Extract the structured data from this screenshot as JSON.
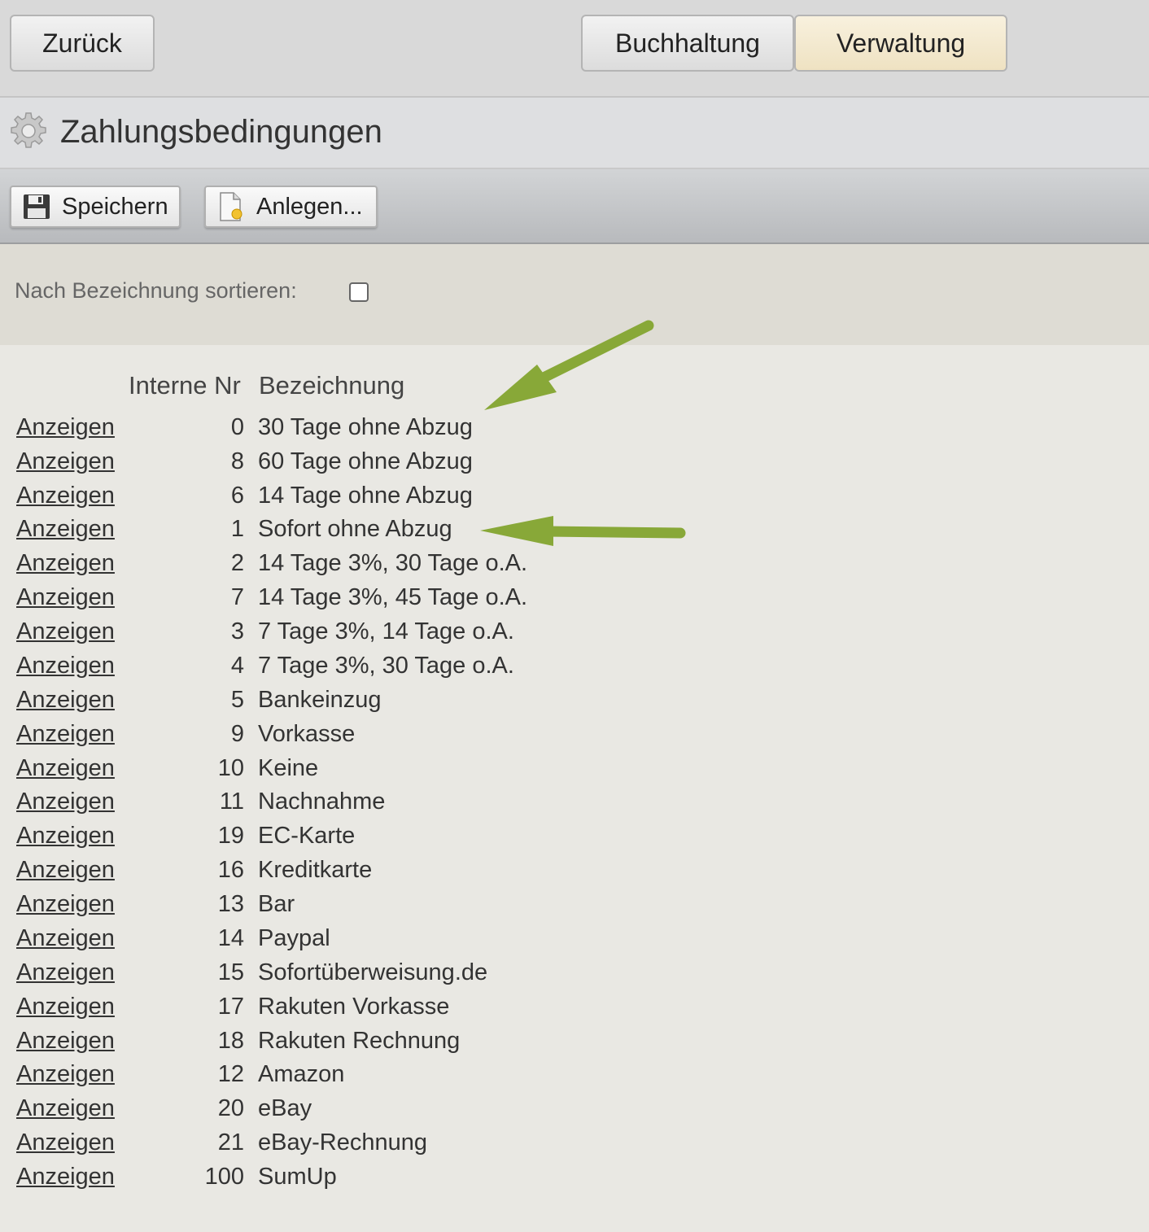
{
  "nav": {
    "back_label": "Zurück",
    "tab_buchhaltung": "Buchhaltung",
    "tab_verwaltung": "Verwaltung",
    "active_tab": "Verwaltung"
  },
  "page": {
    "title": "Zahlungsbedingungen",
    "icon": "gear-icon"
  },
  "toolbar": {
    "save_label": "Speichern",
    "save_icon": "floppy-disk-icon",
    "new_label": "Anlegen...",
    "new_icon": "new-document-icon"
  },
  "filter": {
    "sort_label": "Nach Bezeichnung sortieren:",
    "sort_checked": false
  },
  "table": {
    "headers": {
      "nr": "Interne Nr",
      "bezeichnung": "Bezeichnung"
    },
    "rows": [
      {
        "link": "Anzeigen",
        "nr": "0",
        "bezeichnung": "30 Tage ohne Abzug"
      },
      {
        "link": "Anzeigen",
        "nr": "8",
        "bezeichnung": "60 Tage ohne Abzug"
      },
      {
        "link": "Anzeigen",
        "nr": "6",
        "bezeichnung": "14 Tage ohne Abzug"
      },
      {
        "link": "Anzeigen",
        "nr": "1",
        "bezeichnung": "Sofort ohne Abzug"
      },
      {
        "link": "Anzeigen",
        "nr": "2",
        "bezeichnung": "14 Tage 3%, 30 Tage o.A."
      },
      {
        "link": "Anzeigen",
        "nr": "7",
        "bezeichnung": "14 Tage 3%, 45 Tage o.A."
      },
      {
        "link": "Anzeigen",
        "nr": "3",
        "bezeichnung": "7 Tage 3%, 14 Tage o.A."
      },
      {
        "link": "Anzeigen",
        "nr": "4",
        "bezeichnung": "7 Tage 3%, 30 Tage o.A."
      },
      {
        "link": "Anzeigen",
        "nr": "5",
        "bezeichnung": "Bankeinzug"
      },
      {
        "link": "Anzeigen",
        "nr": "9",
        "bezeichnung": "Vorkasse"
      },
      {
        "link": "Anzeigen",
        "nr": "10",
        "bezeichnung": "Keine"
      },
      {
        "link": "Anzeigen",
        "nr": "11",
        "bezeichnung": "Nachnahme"
      },
      {
        "link": "Anzeigen",
        "nr": "19",
        "bezeichnung": "EC-Karte"
      },
      {
        "link": "Anzeigen",
        "nr": "16",
        "bezeichnung": "Kreditkarte"
      },
      {
        "link": "Anzeigen",
        "nr": "13",
        "bezeichnung": "Bar"
      },
      {
        "link": "Anzeigen",
        "nr": "14",
        "bezeichnung": "Paypal"
      },
      {
        "link": "Anzeigen",
        "nr": "15",
        "bezeichnung": "Sofortüberweisung.de"
      },
      {
        "link": "Anzeigen",
        "nr": "17",
        "bezeichnung": "Rakuten Vorkasse"
      },
      {
        "link": "Anzeigen",
        "nr": "18",
        "bezeichnung": "Rakuten Rechnung"
      },
      {
        "link": "Anzeigen",
        "nr": "12",
        "bezeichnung": "Amazon"
      },
      {
        "link": "Anzeigen",
        "nr": "20",
        "bezeichnung": "eBay"
      },
      {
        "link": "Anzeigen",
        "nr": "21",
        "bezeichnung": "eBay-Rechnung"
      },
      {
        "link": "Anzeigen",
        "nr": "100",
        "bezeichnung": "SumUp"
      }
    ]
  },
  "annotations": {
    "arrow_color": "#88a838",
    "highlighted_rows": [
      "30 Tage ohne Abzug",
      "Sofort ohne Abzug"
    ]
  }
}
